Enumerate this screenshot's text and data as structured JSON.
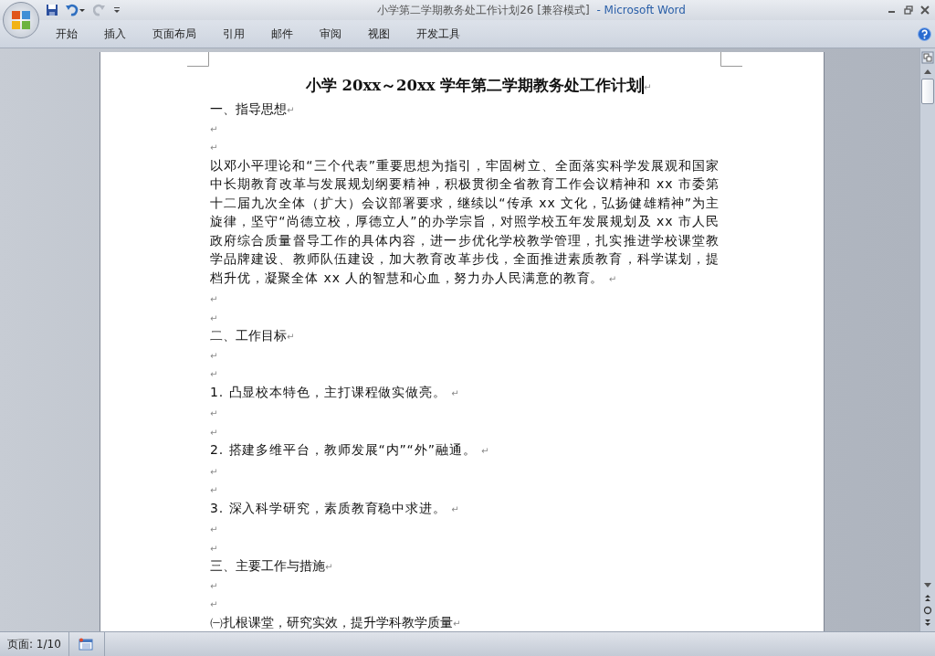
{
  "window": {
    "title": "小学第二学期教务处工作计划26 [兼容模式]",
    "app": "- Microsoft Word"
  },
  "quick_access": [
    {
      "kind": "save",
      "disabled": false
    },
    {
      "kind": "undo",
      "disabled": false
    },
    {
      "kind": "redo",
      "disabled": true
    }
  ],
  "tabs": [
    {
      "label": "开始",
      "selected": false
    },
    {
      "label": "插入",
      "selected": false
    },
    {
      "label": "页面布局",
      "selected": false
    },
    {
      "label": "引用",
      "selected": false
    },
    {
      "label": "邮件",
      "selected": false
    },
    {
      "label": "审阅",
      "selected": false
    },
    {
      "label": "视图",
      "selected": false
    },
    {
      "label": "开发工具",
      "selected": false
    }
  ],
  "document": {
    "title": "小学 20xx～20xx 学年第二学期教务处工作计划",
    "title_mark": "↵",
    "paragraphs": [
      {
        "kind": "heading",
        "text": "一、指导思想",
        "mark": "↵"
      },
      {
        "kind": "empty",
        "mark": "↵"
      },
      {
        "kind": "empty",
        "mark": "↵"
      },
      {
        "kind": "body",
        "text": "以邓小平理论和“三个代表”重要思想为指引，牢固树立、全面落实科学发展观和国家中长期教育改革与发展规划纲要精神，积极贯彻全省教育工作会议精神和 xx 市委第十二届九次全体（扩大）会议部署要求，继续以“传承 xx 文化，弘扬健雄精神”为主旋律，坚守“尚德立校，厚德立人”的办学宗旨，对照学校五年发展规划及 xx 市人民政府综合质量督导工作的具体内容，进一步优化学校教学管理，扎实推进学校课堂教学品牌建设、教师队伍建设，加大教育改革步伐，全面推进素质教育，科学谋划，提档升优，凝聚全体 xx 人的智慧和心血，努力办人民满意的教育。",
        "mark": "↵"
      },
      {
        "kind": "empty",
        "mark": "↵"
      },
      {
        "kind": "empty",
        "mark": "↵"
      },
      {
        "kind": "heading",
        "text": "二、工作目标",
        "mark": "↵"
      },
      {
        "kind": "empty",
        "mark": "↵"
      },
      {
        "kind": "empty",
        "mark": "↵"
      },
      {
        "kind": "body",
        "text": "1. 凸显校本特色，主打课程做实做亮。",
        "mark": "↵"
      },
      {
        "kind": "empty",
        "mark": "↵"
      },
      {
        "kind": "empty",
        "mark": "↵"
      },
      {
        "kind": "body",
        "text": "2. 搭建多维平台，教师发展“内”“外”融通。",
        "mark": "↵"
      },
      {
        "kind": "empty",
        "mark": "↵"
      },
      {
        "kind": "empty",
        "mark": "↵"
      },
      {
        "kind": "body",
        "text": "3. 深入科学研究，素质教育稳中求进。",
        "mark": "↵"
      },
      {
        "kind": "empty",
        "mark": "↵"
      },
      {
        "kind": "empty",
        "mark": "↵"
      },
      {
        "kind": "heading",
        "text": "三、主要工作与措施",
        "mark": "↵"
      },
      {
        "kind": "empty",
        "mark": "↵"
      },
      {
        "kind": "empty",
        "mark": "↵"
      },
      {
        "kind": "heading",
        "text": "㈠扎根课堂，研究实效，提升学科教学质量",
        "mark": "↵"
      }
    ]
  },
  "status_bar": {
    "page": "页面: 1/10"
  }
}
